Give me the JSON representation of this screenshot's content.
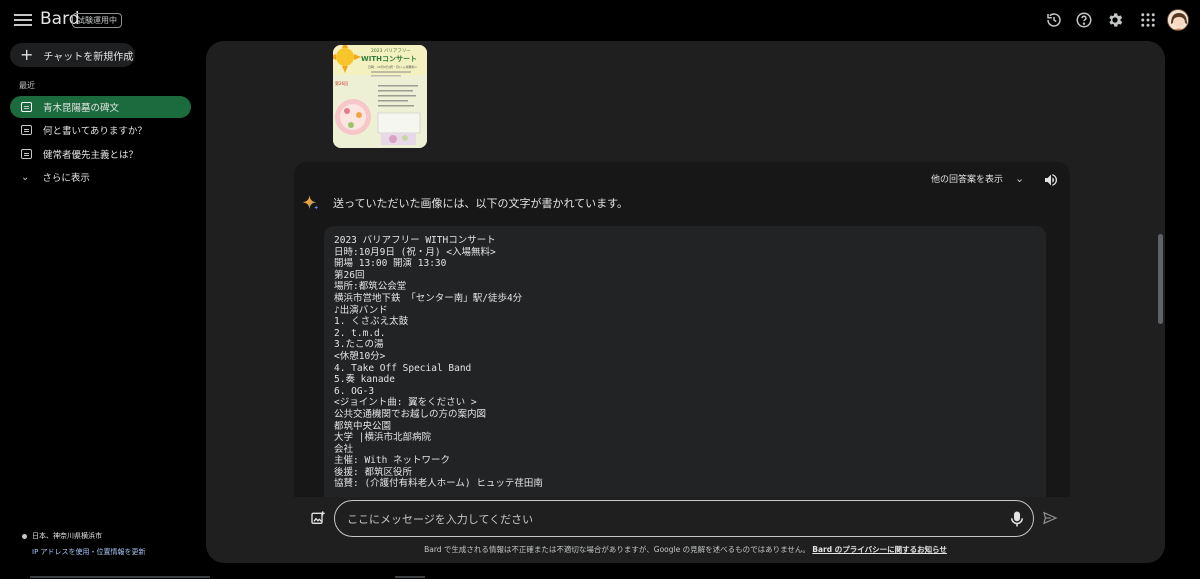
{
  "app": {
    "name": "Bard",
    "badge": "試験運用中"
  },
  "topbar": {
    "icons": [
      "history-icon",
      "help-icon",
      "settings-icon",
      "apps-grid-icon",
      "avatar"
    ]
  },
  "sidebar": {
    "new_chat_label": "チャットを新規作成",
    "recent_label": "最近",
    "items": [
      {
        "label": "青木昆陽墓の碑文",
        "active": true
      },
      {
        "label": "何と書いてありますか？",
        "active": false
      },
      {
        "label": "健常者優先主義とは？",
        "active": false
      }
    ],
    "show_more_label": "さらに表示",
    "location": "日本、神奈川県横浜市",
    "location_link": "IP アドレスを使用・位置情報を更新"
  },
  "conversation": {
    "other_drafts_label": "他の回答案を表示",
    "intro": "送っていただいた画像には、以下の文字が書かれています。",
    "code_lines": [
      "2023 バリアフリー WITHコンサート",
      "日時:10月9日 (祝・月) <入場無料>",
      "開場 13:00 開演 13:30",
      "第26回",
      "場所:都筑公会堂",
      "横浜市営地下鉄 「センター南」駅/徒歩4分",
      "♪出演バンド",
      "1. くさぶえ太鼓",
      "2. t.m.d.",
      "3.たこの湯",
      "<休憩10分>",
      "4. Take Off Special Band",
      "5.奏 kanade",
      "6. OG-3",
      "<ジョイント曲: 翼をください >",
      "公共交通機関でお越しの方の案内図",
      "都筑中央公園",
      "大学 |横浜市北部病院",
      "会社",
      "主催: With ネットワーク",
      "後援: 都筑区役所",
      "協賛: (介護付有料老人ホーム) ヒュッテ荏田南"
    ]
  },
  "poster_thumbnail": {
    "year_title": "2023 バリアフリー",
    "title": "WITHコンサート",
    "edition": "第26回",
    "info_line": "日時：10月9日(祝・月)<入場無料>"
  },
  "input": {
    "placeholder": "ここにメッセージを入力してください"
  },
  "footer": {
    "disclaimer": "Bard で生成される情報は不正確または不適切な場合がありますが、Google の見解を述べるものではありません。",
    "privacy_link": "Bard のプライバシーに関するお知らせ"
  },
  "colors": {
    "background": "#000000",
    "panel": "#1f1f20",
    "active_item": "#1c6b3e",
    "link": "#a8c7fa"
  }
}
